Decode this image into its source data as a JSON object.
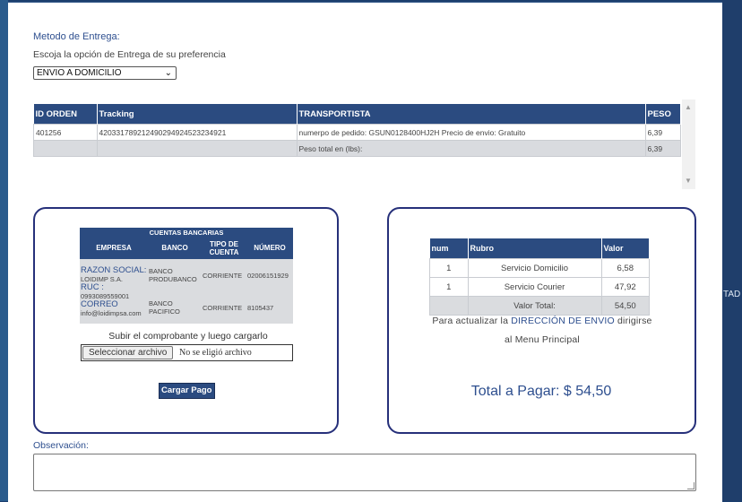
{
  "background": {
    "right_text": "TAD"
  },
  "delivery": {
    "heading": "Metodo de Entrega:",
    "instruction": "Escoja la opción de Entrega de su preferencia",
    "selected": "ENVIO A DOMICILIO"
  },
  "orders": {
    "headers": {
      "id": "ID ORDEN",
      "tracking": "Tracking",
      "carrier": "TRANSPORTISTA",
      "weight": "PESO"
    },
    "row": {
      "id": "401256",
      "tracking": "420331789212490294924523234921",
      "carrier": "numerpo de pedido: GSUN0128400HJ2H Precio de envio: Gratuito",
      "weight": "6,39"
    },
    "total": {
      "label": "Peso total en (lbs):",
      "value": "6,39"
    }
  },
  "bank_accounts": {
    "title": "CUENTAS BANCARIAS",
    "headers": {
      "company": "EMPRESA",
      "bank": "BANCO",
      "type": "TIPO DE CUENTA",
      "number": "NÚMERO"
    },
    "company": {
      "razon_label": "RAZON SOCIAL:",
      "razon": "LOIDIMP S.A.",
      "ruc_label": "RUC :",
      "ruc": "0993089559001",
      "correo_label": "CORREO",
      "correo": "info@loidimpsa.com"
    },
    "rows": [
      {
        "bank": "BANCO PRODUBANCO",
        "type": "CORRIENTE",
        "number": "02006151929"
      },
      {
        "bank": "BANCO PACIFICO",
        "type": "CORRIENTE",
        "number": "8105437"
      }
    ]
  },
  "upload": {
    "label": "Subir el comprobante y luego cargarlo",
    "button": "Seleccionar archivo",
    "status": "No se eligió archivo",
    "submit": "Cargar Pago"
  },
  "summary": {
    "headers": {
      "num": "num",
      "rubro": "Rubro",
      "valor": "Valor"
    },
    "rows": [
      {
        "num": "1",
        "rubro": "Servicio Domicilio",
        "valor": "6,58"
      },
      {
        "num": "1",
        "rubro": "Servicio Courier",
        "valor": "47,92"
      }
    ],
    "total": {
      "label": "Valor Total:",
      "value": "54,50"
    },
    "note_prefix": "Para actualizar la",
    "note_link": "DIRECCIÓN DE ENVIO",
    "note_suffix": "dirigirse",
    "note_line2": "al Menu Principal",
    "total_pay": "Total a Pagar: $ 54,50"
  },
  "observation": {
    "label": "Observación:",
    "value": ""
  },
  "colors": {
    "accent": "#2b4b80",
    "box_border": "#26307a",
    "link": "#2e4f8f"
  }
}
